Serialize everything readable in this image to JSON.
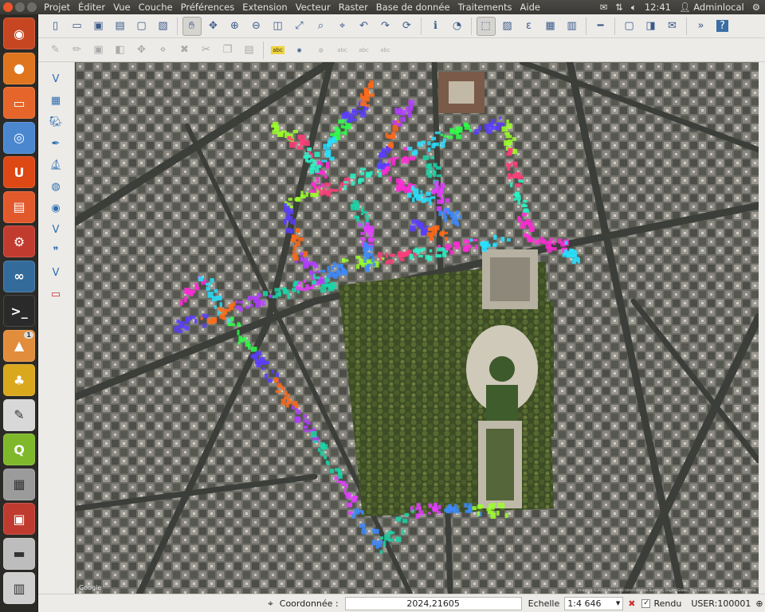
{
  "menubar": {
    "menus": [
      "Projet",
      "Éditer",
      "Vue",
      "Couche",
      "Préférences",
      "Extension",
      "Vecteur",
      "Raster",
      "Base de donnée",
      "Traitements",
      "Aide"
    ],
    "clock": "12:41",
    "user": "Adminlocal"
  },
  "launcher": {
    "items": [
      {
        "name": "dash-home",
        "glyph": "◉",
        "color": "#c74622"
      },
      {
        "name": "firefox",
        "glyph": "●",
        "color": "#e0751f"
      },
      {
        "name": "files",
        "glyph": "▭",
        "color": "#e5652a"
      },
      {
        "name": "chromium",
        "glyph": "◎",
        "color": "#4a87cf"
      },
      {
        "name": "ubuntu-one",
        "glyph": "U",
        "color": "#dd4814"
      },
      {
        "name": "software-center",
        "glyph": "▤",
        "color": "#e2592b"
      },
      {
        "name": "system-settings",
        "glyph": "⚙",
        "color": "#c23b2f"
      },
      {
        "name": "pgadmin",
        "glyph": "∞",
        "color": "#336b9a"
      },
      {
        "name": "terminal",
        "glyph": ">_",
        "color": "#2a2a2a"
      },
      {
        "name": "update-manager",
        "glyph": "▲",
        "color": "#e28d3c",
        "badge": "1"
      },
      {
        "name": "transmission",
        "glyph": "♣",
        "color": "#d9a81c"
      },
      {
        "name": "text-editor",
        "glyph": "✎",
        "color": "#d8d8d8"
      },
      {
        "name": "qgis",
        "glyph": "Q",
        "color": "#7fb82a"
      },
      {
        "name": "calculator",
        "glyph": "▦",
        "color": "#9b9b9b"
      },
      {
        "name": "workspace-switcher",
        "glyph": "▣",
        "color": "#bf3b2f"
      },
      {
        "name": "removable-drive",
        "glyph": "▬",
        "color": "#bdbdbd"
      },
      {
        "name": "trash",
        "glyph": "▥",
        "color": "#cfcfcf"
      }
    ]
  },
  "toolbar1": {
    "icons": [
      "new-project-icon",
      "open-project-icon",
      "save-project-icon",
      "save-as-icon",
      "new-print-composer-icon",
      "composer-manager-icon",
      "sep",
      "pan-map-icon",
      "pan-to-selection-icon",
      "zoom-in-icon",
      "zoom-out-icon",
      "zoom-native-icon",
      "zoom-full-icon",
      "zoom-to-selection-icon",
      "zoom-to-layer-icon",
      "zoom-last-icon",
      "zoom-next-icon",
      "refresh-icon",
      "sep",
      "identify-icon",
      "measure-icon",
      "sep",
      "select-features-icon",
      "deselect-icon",
      "expression-select-icon",
      "attribute-table-icon",
      "field-calculator-icon",
      "sep",
      "measure-line-icon",
      "sep",
      "map-tips-icon",
      "new-bookmark-icon",
      "text-annotation-icon",
      "sep",
      "more-icon",
      "help-icon"
    ]
  },
  "toolbar2": {
    "icons": [
      "current-edits-icon",
      "toggle-editing-icon",
      "save-edits-icon",
      "add-feature-icon",
      "move-feature-icon",
      "node-tool-icon",
      "delete-selected-icon",
      "cut-features-icon",
      "copy-features-icon",
      "paste-features-icon",
      "sep",
      "label-toolbar-icon",
      "pin-labels-icon",
      "show-hide-labels-icon",
      "move-label-icon",
      "rotate-label-icon",
      "change-label-icon"
    ]
  },
  "lefttools": {
    "icons": [
      "add-vector-layer-icon",
      "add-raster-layer-icon",
      "add-postgis-layer-icon",
      "add-spatialite-layer-icon",
      "add-mssql-layer-icon",
      "add-wms-layer-icon",
      "add-wcs-layer-icon",
      "add-wfs-layer-icon",
      "add-delimited-text-icon",
      "new-shapefile-icon",
      "remove-layer-icon"
    ]
  },
  "map": {
    "attribution_left": "Google",
    "attribution_right": "Imagery ©2014 Aerodata International Surveys, DigitalGlobe, The GeoInformation Group, Infoterra"
  },
  "statusbar": {
    "coord_label": "Coordonnée :",
    "coord_value": "2024,21605",
    "scale_label": "Echelle",
    "scale_value": "1:4 646",
    "render_label": "Rendu",
    "render_checked": true,
    "crs": "USER:100001"
  }
}
